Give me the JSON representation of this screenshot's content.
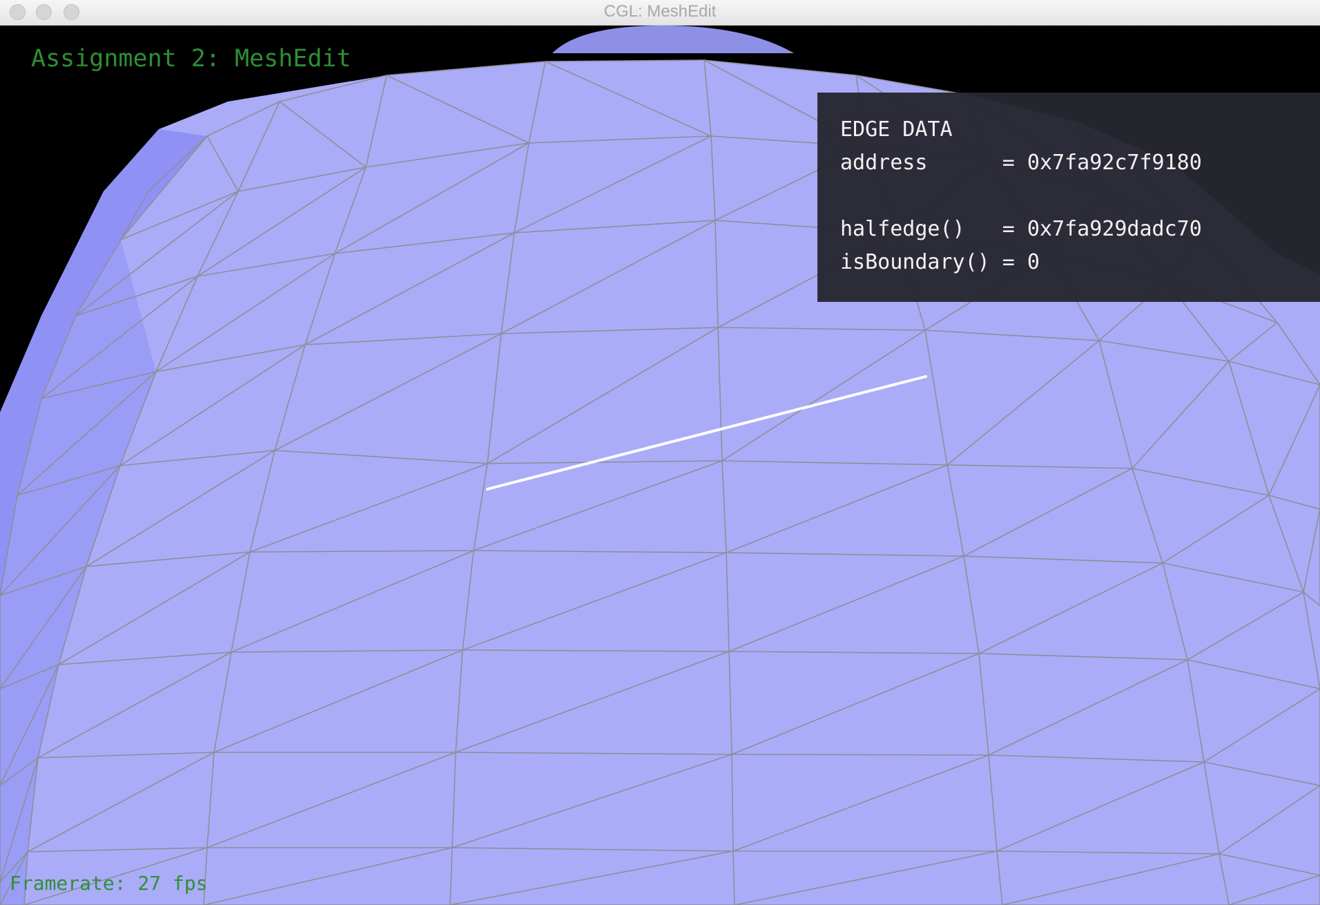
{
  "window": {
    "title": "CGL: MeshEdit"
  },
  "hud": {
    "assignment_title": "Assignment 2: MeshEdit",
    "framerate": "Framerate: 27 fps",
    "text_color": "#2f8f35"
  },
  "edge_panel": {
    "heading": "EDGE DATA",
    "address_line": "address      = 0x7fa92c7f9180",
    "blank_line": "",
    "halfedge_line": "halfedge()   = 0x7fa929dadc70",
    "boundary_line": "isBoundary() = 0"
  },
  "mesh": {
    "face_color": "#aaacf8",
    "wire_color": "#8e8e98",
    "selected_edge_color": "#ffffff"
  }
}
